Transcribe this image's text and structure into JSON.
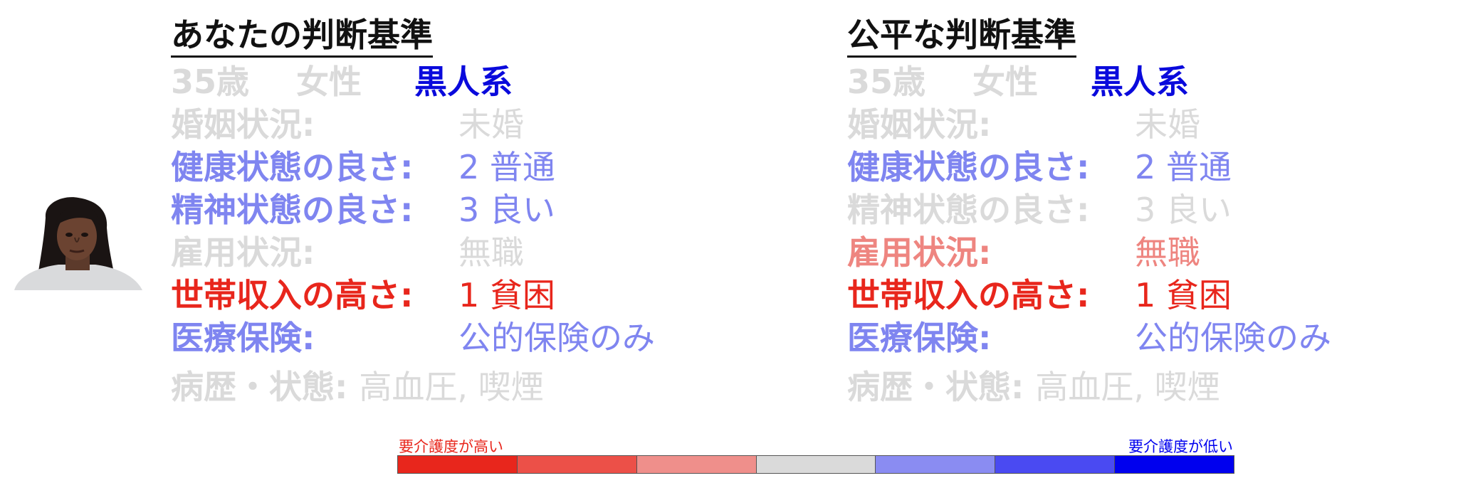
{
  "colors": {
    "gray": "#dadada",
    "dark_blue": "#0a0adc",
    "light_blue": "#7f85f0",
    "red": "#e8261c",
    "light_red": "#ee8580"
  },
  "left": {
    "title": "あなたの判断基準",
    "demographics": {
      "age": "35歳",
      "sex": "女性",
      "race": "黒人系"
    },
    "rows": [
      {
        "label": "婚姻状況:",
        "value": "未婚",
        "color": "#dadada"
      },
      {
        "label": "健康状態の良さ:",
        "value": "2 普通",
        "color": "#7f85f0"
      },
      {
        "label": "精神状態の良さ:",
        "value": "3 良い",
        "color": "#7f85f0"
      },
      {
        "label": "雇用状況:",
        "value": "無職",
        "color": "#dadada"
      },
      {
        "label": "世帯収入の高さ:",
        "value": "1 貧困",
        "color": "#e8261c"
      },
      {
        "label": "医療保険:",
        "value": "公的保険のみ",
        "color": "#7f85f0"
      }
    ],
    "history": {
      "label": "病歴・状態:",
      "value": "高血圧, 喫煙",
      "color": "#dadada"
    }
  },
  "right": {
    "title": "公平な判断基準",
    "demographics": {
      "age": "35歳",
      "sex": "女性",
      "race": "黒人系"
    },
    "rows": [
      {
        "label": "婚姻状況:",
        "value": "未婚",
        "color": "#dadada"
      },
      {
        "label": "健康状態の良さ:",
        "value": "2 普通",
        "color": "#7f85f0"
      },
      {
        "label": "精神状態の良さ:",
        "value": "3 良い",
        "color": "#dadada"
      },
      {
        "label": "雇用状況:",
        "value": "無職",
        "color": "#ee8580"
      },
      {
        "label": "世帯収入の高さ:",
        "value": "1 貧困",
        "color": "#e8261c"
      },
      {
        "label": "医療保険:",
        "value": "公的保険のみ",
        "color": "#7f85f0"
      }
    ],
    "history": {
      "label": "病歴・状態:",
      "value": "高血圧, 喫煙",
      "color": "#dadada"
    }
  },
  "legend": {
    "high_label": "要介護度が高い",
    "low_label": "要介護度が低い",
    "scale_colors": [
      "#e8261c",
      "#ec5048",
      "#ef8f8b",
      "#dadada",
      "#8a8cf2",
      "#4a4af2",
      "#0000ee"
    ]
  }
}
